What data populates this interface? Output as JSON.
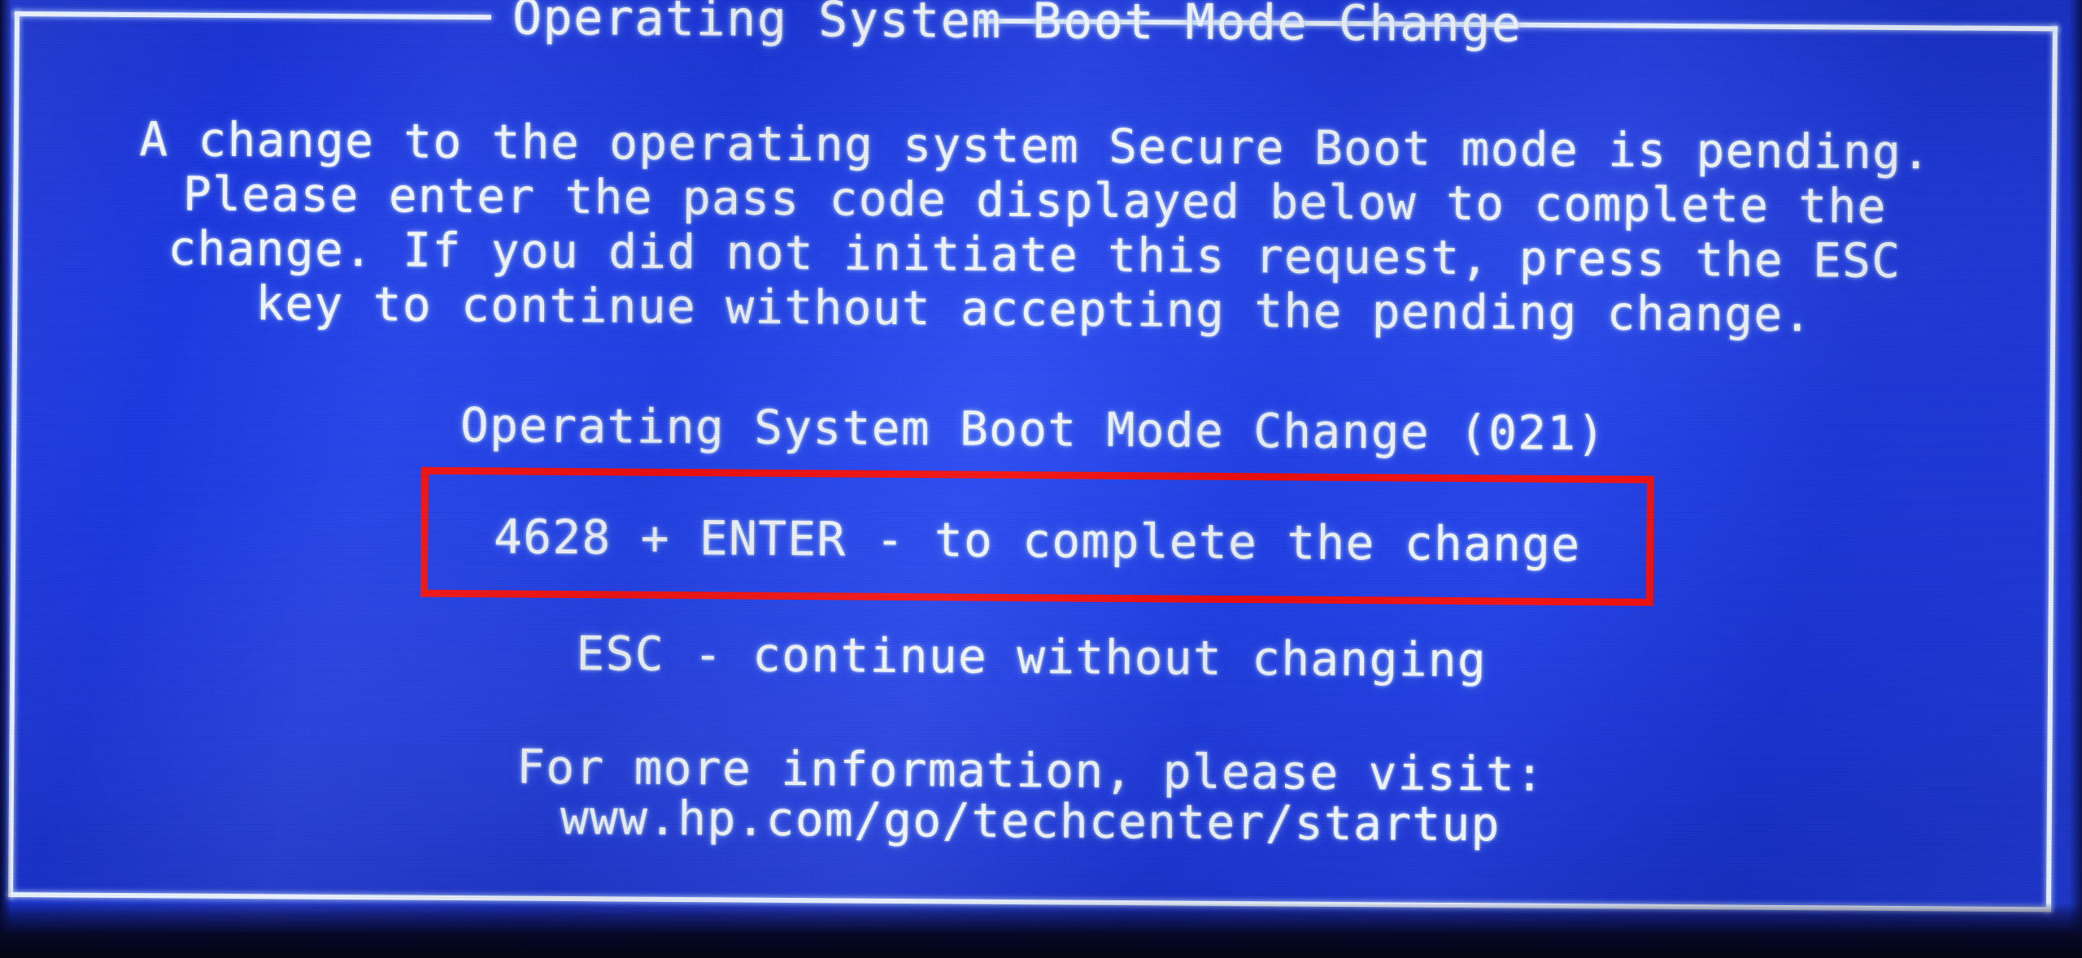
{
  "screen": {
    "kind": "bios-secure-boot-dialog",
    "background_color": "#2040EC",
    "text_color": "#F2F7FF",
    "frame_color": "#EAF2FF",
    "highlight_color": "#F50D0D"
  },
  "dialog": {
    "title": "Operating System Boot Mode Change",
    "message_lines": [
      "A change to the operating system Secure Boot mode is pending.",
      "Please enter the pass code displayed below to complete the",
      "change. If you did not initiate this request, press the ESC",
      "key to continue without accepting the pending change."
    ],
    "headline": "Operating System Boot Mode Change (021)",
    "event_code": "021",
    "pass_code": "4628",
    "passcode_instruction": "4628 + ENTER - to complete the change",
    "escape_instruction": "ESC - continue without changing",
    "footer_prompt": "For more information, please visit:",
    "footer_url": "www.hp.com/go/techcenter/startup"
  }
}
